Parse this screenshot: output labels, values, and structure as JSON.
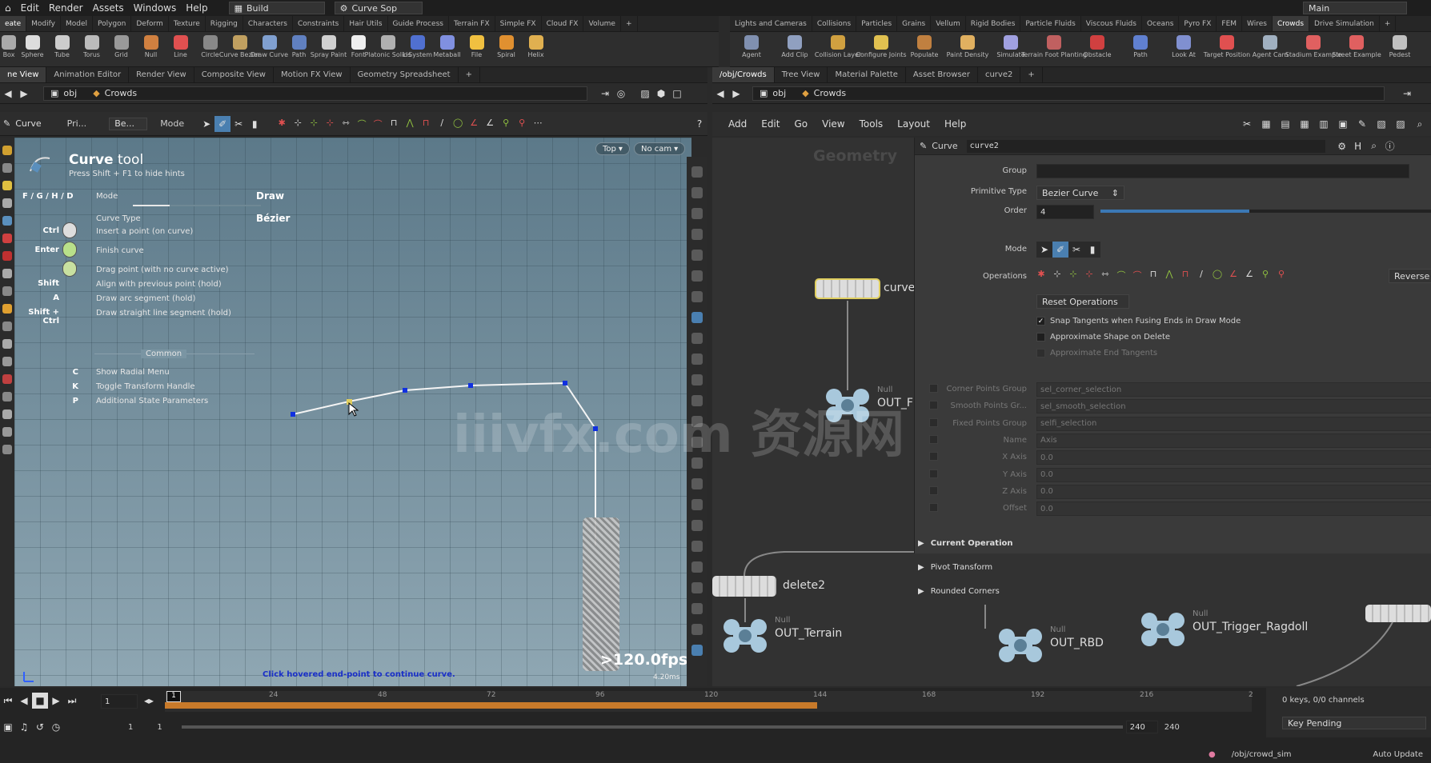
{
  "menu": [
    "Edit",
    "Render",
    "Assets",
    "Windows",
    "Help"
  ],
  "desktop_left": "Build",
  "desktop_mid": "Curve Sop",
  "desktop_right": "Main",
  "shelf_tabs_left": [
    "eate",
    "Modify",
    "Model",
    "Polygon",
    "Deform",
    "Texture",
    "Rigging",
    "Characters",
    "Constraints",
    "Hair Utils",
    "Guide Process",
    "Terrain FX",
    "Simple FX",
    "Cloud FX",
    "Volume"
  ],
  "shelf_tabs_right": [
    "Lights and Cameras",
    "Collisions",
    "Particles",
    "Grains",
    "Vellum",
    "Rigid Bodies",
    "Particle Fluids",
    "Viscous Fluids",
    "Oceans",
    "Pyro FX",
    "FEM",
    "Wires",
    "Crowds",
    "Drive Simulation"
  ],
  "shelf_tools_left": [
    "Box",
    "Sphere",
    "Tube",
    "Torus",
    "Grid",
    "Null",
    "Line",
    "Circle",
    "Curve Bezier",
    "Draw Curve",
    "Path",
    "Spray Paint",
    "Font",
    "Platonic Solids",
    "L-System",
    "Metaball",
    "File",
    "Spiral",
    "Helix"
  ],
  "shelf_tools_right": [
    "Agent",
    "Add Clip",
    "Collision Layer",
    "Configure Joints",
    "Populate",
    "Paint Density",
    "Simulate",
    "Terrain Foot Planting",
    "Obstacle",
    "Path",
    "Look At",
    "Target Position",
    "Agent Cam",
    "Stadium Example",
    "Street Example",
    "Pedest"
  ],
  "pane_tabs_left": [
    "ne View",
    "Animation Editor",
    "Render View",
    "Composite View",
    "Motion FX View",
    "Geometry Spreadsheet"
  ],
  "pane_tabs_right": [
    "/obj/Crowds",
    "Tree View",
    "Material Palette",
    "Asset Browser",
    "curve2"
  ],
  "path_obj": "obj",
  "path_net": "Crowds",
  "tool_bar": {
    "tool": "Curve",
    "pri": "Pri...",
    "be": "Be...",
    "mode": "Mode"
  },
  "net_menu": [
    "Add",
    "Edit",
    "Go",
    "View",
    "Tools",
    "Layout",
    "Help"
  ],
  "viewport": {
    "view_btn": "Top",
    "cam_btn": "No cam",
    "hint_title_bold": "Curve",
    "hint_title_rest": " tool",
    "hint_sub": "Press Shift + F1 to hide hints",
    "keys_fghd": "F / G / H / D",
    "mode_label": "Mode",
    "mode_val": "Draw",
    "ctype_label": "Curve Type",
    "ctype_val": "Bézier",
    "rows": [
      {
        "k": "Ctrl",
        "t": "Insert a point (on curve)"
      },
      {
        "k": "Enter",
        "t": "Finish curve"
      },
      {
        "k": "",
        "t": "Drag point (with no curve active)"
      },
      {
        "k": "Shift",
        "t": "Align with previous point (hold)"
      },
      {
        "k": "A",
        "t": "Draw arc segment (hold)"
      },
      {
        "k": "Shift + Ctrl",
        "t": "Draw straight line segment (hold)"
      }
    ],
    "common": "Common",
    "rows2": [
      {
        "k": "C",
        "t": "Show Radial Menu"
      },
      {
        "k": "K",
        "t": "Toggle Transform Handle"
      },
      {
        "k": "P",
        "t": "Additional State Parameters"
      }
    ],
    "status": "Click hovered end-point to continue curve.",
    "fps": ">120.0fps",
    "ms": "4.20ms"
  },
  "network_label": "Geometry",
  "params": {
    "type": "Curve",
    "name": "curve2",
    "group_label": "Group",
    "prim_label": "Primitive Type",
    "prim_val": "Bezier Curve",
    "order_label": "Order",
    "order_val": "4",
    "order_fraction": 0.45,
    "mode_label": "Mode",
    "ops_label": "Operations",
    "reverse": "Reverse",
    "reset": "Reset Operations",
    "c1": "Snap Tangents when Fusing Ends in Draw Mode",
    "c2": "Approximate Shape on Delete",
    "c3": "Approximate End Tangents",
    "dis_labels": [
      "Corner Points Group",
      "Smooth Points Gr...",
      "Fixed Points Group",
      "Name",
      "X Axis",
      "Y Axis",
      "Z Axis",
      "Offset"
    ],
    "dis_vals": [
      "sel_corner_selection",
      "sel_smooth_selection",
      "selfi_selection",
      "Axis",
      "0.0",
      "0.0",
      "0.0",
      "0.0"
    ],
    "sections": [
      "Current Operation",
      "Pivot Transform",
      "Rounded Corners"
    ]
  },
  "nodes": {
    "curve": "curve",
    "null_type": "Null",
    "out_f": "OUT_F",
    "delete2": "delete2",
    "out_terrain": "OUT_Terrain",
    "out_rbd": "OUT_RBD",
    "out_trigger": "OUT_Trigger_Ragdoll"
  },
  "timeline": {
    "frame": "1",
    "cur": "1",
    "ticks": [
      "24",
      "48",
      "72",
      "96",
      "120",
      "144",
      "168",
      "192",
      "216",
      "2"
    ],
    "start": "1",
    "start2": "1",
    "end": "240",
    "end2": "240",
    "keys": "0 keys, 0/0 channels",
    "keypending": "Key Pending",
    "path": "/obj/crowd_sim",
    "autoupdate": "Auto Update",
    "range_fraction": 0.6
  },
  "watermark": "iiivfx.com 资源网",
  "colors": {
    "accent": "#e0cf60",
    "range": "#c87a2a",
    "point": "#1030e0"
  }
}
